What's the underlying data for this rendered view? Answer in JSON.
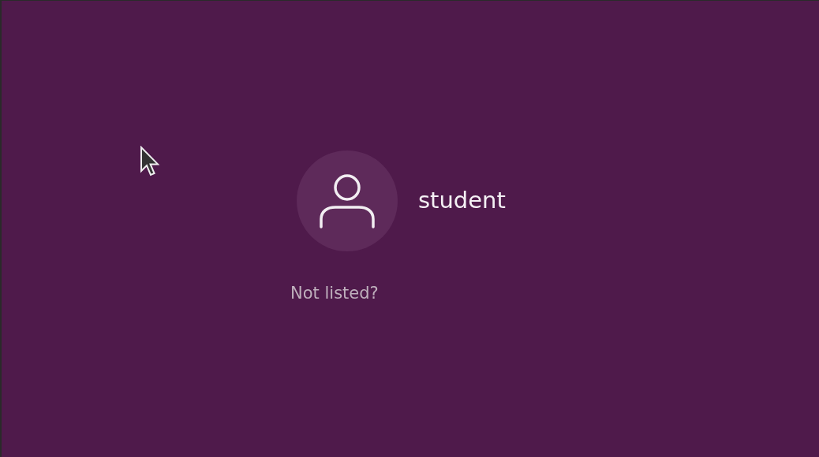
{
  "users": [
    {
      "name": "student",
      "selected": false
    }
  ],
  "not_listed": {
    "label": "Not listed?"
  }
}
